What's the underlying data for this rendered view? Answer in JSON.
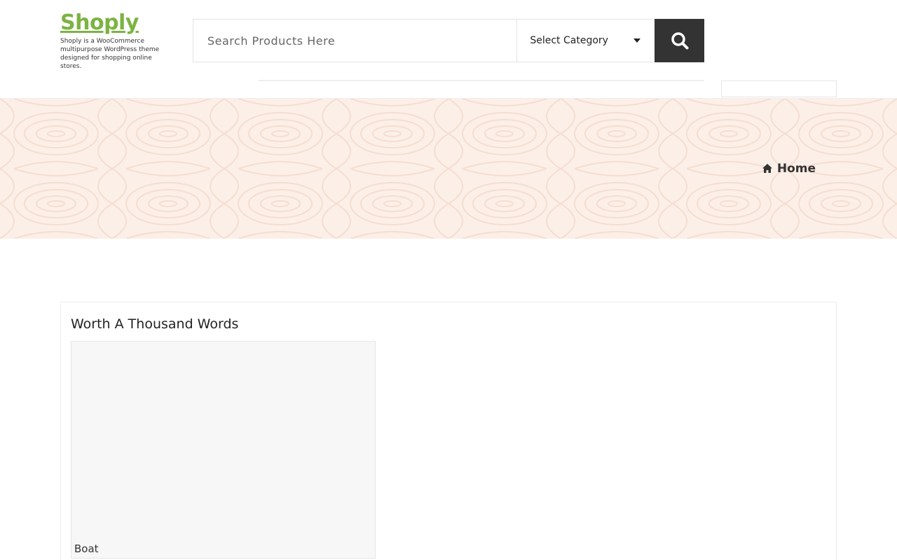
{
  "brand": {
    "name": "Shoply",
    "tagline": "Shoply is a WooCommerce multipurpose WordPress theme designed for shopping online stores.",
    "color": "#7cb342"
  },
  "search": {
    "placeholder": "Search Products Here",
    "value": "",
    "category_label": "Select Category",
    "button_icon": "search-icon",
    "button_color": "#333333"
  },
  "banner": {
    "background": "#fcefe7",
    "breadcrumb": {
      "icon": "home-icon",
      "label": "Home"
    }
  },
  "widget": {
    "title": "Worth A Thousand Words",
    "gallery": [
      {
        "caption": "Boat"
      }
    ]
  }
}
